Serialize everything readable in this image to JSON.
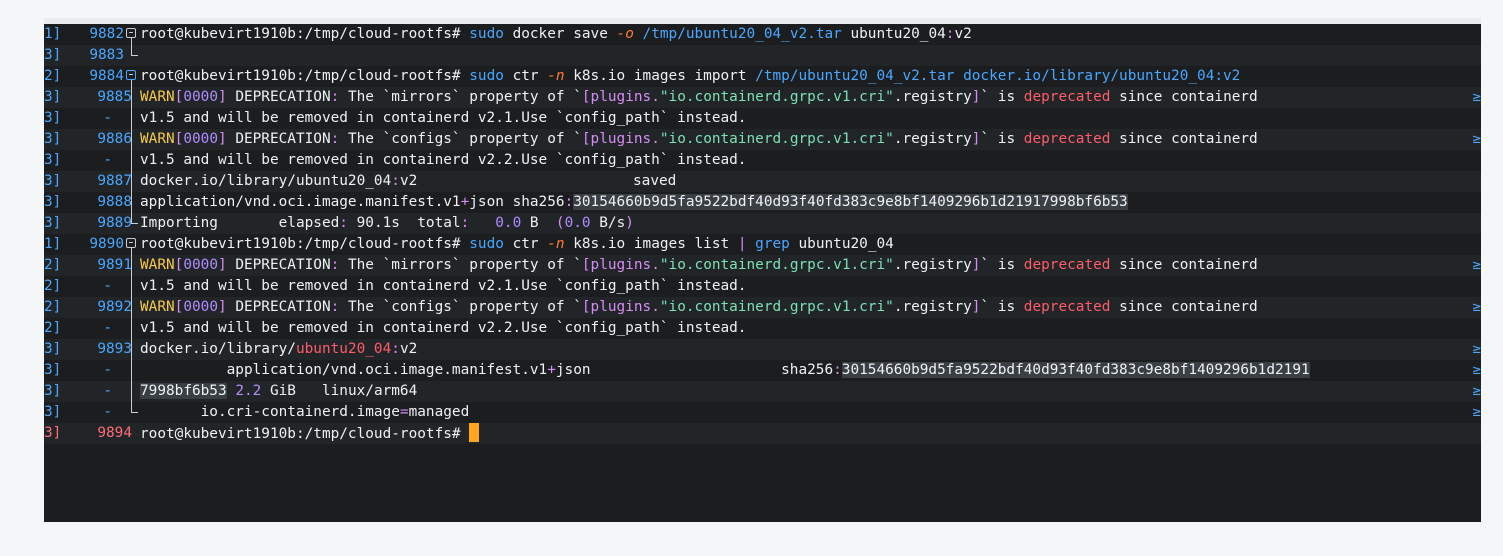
{
  "terminal": {
    "prompt": "root@kubevirt1910b:/tmp/cloud-rootfs#",
    "cursor_color": "#ffa51f",
    "colors": {
      "background": "#1b1d1f",
      "line_number": "#4aa6ff",
      "current_line_number": "#ff6b7a",
      "warn": "#f5c94a",
      "deprecated": "#ff5b6a",
      "string": "#7be0b4"
    },
    "gutter": {
      "left_brackets": [
        "1]",
        "3]",
        "2]",
        "3]",
        "3]",
        "3]",
        "3]",
        "3]",
        "3]",
        "3]",
        "1]",
        "2]",
        "2]",
        "2]",
        "2]",
        "3]",
        "3]",
        "3]",
        "3]",
        "3]"
      ],
      "line_numbers": [
        "9882",
        "9883",
        "9884",
        "9885",
        "-",
        "9886",
        "-",
        "9887",
        "9888",
        "9889",
        "9890",
        "9891",
        "-",
        "9892",
        "-",
        "9893",
        "-",
        "-",
        "-",
        "9894"
      ]
    },
    "lines": {
      "l0": {
        "a": "sudo",
        "b": " docker save ",
        "c": "-o",
        "d": " /tmp/ubuntu20_04_v2.tar",
        "e": " ubuntu20_04",
        "f": ":",
        "g": "v2"
      },
      "l2": {
        "a": "sudo",
        "b": " ctr ",
        "c": "-n",
        "d": " k8s.io images import ",
        "e": "/tmp/ubuntu20_04_v2.tar docker.io/library/ubuntu20_04:v2"
      },
      "warn_prefix": "WARN",
      "warn_num": "0000",
      "deprecation": " DEPRECATION",
      "colon": ":",
      "mirrors_text": " The `mirrors` property of `",
      "configs_text": " The `configs` property of `",
      "plugins": "[plugins.",
      "cri_str": "\"io.containerd.grpc.v1.cri\"",
      "registry": ".registry",
      "close_br": "]",
      "is_text": "` is ",
      "deprecated": "deprecated",
      "since_text": " since containerd",
      "cont_21": "v1.5 and will be removed in containerd v2.1.Use `config_path` instead.",
      "cont_22": "v1.5 and will be removed in containerd v2.2.Use `config_path` instead.",
      "l7": {
        "a": "docker.io/library/ubuntu20_04",
        "b": ":",
        "c": "v2",
        "d": "saved"
      },
      "l8": {
        "a": "application/vnd.oci.image.manifest.v1",
        "b": "+",
        "c": "json sha256",
        "d": ":",
        "e": "30154660b9d5fa9522bdf40d93f40fd383c9e8bf1409296b1d21917998bf6b53"
      },
      "l9": {
        "a": "Importing       elapsed",
        "b": ":",
        "c": " 90.1s  total",
        "d": ":",
        "e": "   ",
        "f": "0.0",
        "g": " B  ",
        "h": "(",
        "i": "0.0",
        "j": " B/s",
        "k": ")"
      },
      "l10": {
        "a": "sudo",
        "b": " ctr ",
        "c": "-n",
        "d": " k8s.io images list ",
        "e": "|",
        "f": " grep",
        "g": " ubuntu20_04"
      },
      "l15": {
        "a": "docker.io/library/",
        "b": "ubuntu20_04",
        "c": ":",
        "d": "v2"
      },
      "l16": {
        "a": "          application/vnd.oci.image.manifest.v1",
        "b": "+",
        "c": "json                      sha256",
        "d": ":",
        "e": "30154660b9d5fa9522bdf40d93f40fd383c9e8bf1409296b1d2191"
      },
      "l17": {
        "a": "7998bf6b53",
        "b": " ",
        "c": "2.2",
        "d": " GiB   linux/arm64"
      },
      "l18": {
        "a": "       io.cri-containerd.image",
        "b": "=",
        "c": "managed"
      },
      "edge_glyph": "≥"
    }
  }
}
